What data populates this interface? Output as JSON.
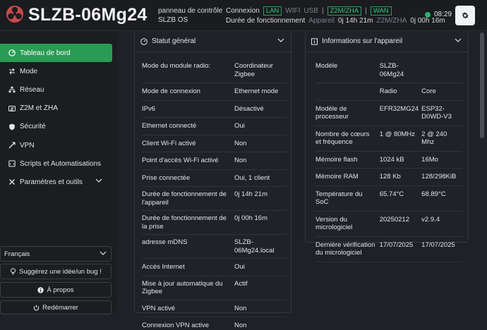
{
  "header": {
    "brand": "SLZB-06Mg24",
    "subtitle_line1": "panneau de contrôle",
    "subtitle_line2": "SLZB OS",
    "connection_label": "Connexion",
    "lan": "LAN",
    "wifi": "WIFI",
    "usb": "USB",
    "z2m_zha": "Z2M/ZHA",
    "wan": "WAN",
    "uptime_label": "Durée de fonctionnement",
    "appareil": "Appareil",
    "appareil_uptime": "0j 14h 21m",
    "z2m_label": "Z2M/ZHA",
    "z2m_uptime": "0j 00h 16m",
    "time": "08:29"
  },
  "sidebar": {
    "items": [
      {
        "label": "Tableau de bord",
        "icon": "dashboard-icon"
      },
      {
        "label": "Mode",
        "icon": "arrows-icon"
      },
      {
        "label": "Réseau",
        "icon": "network-icon"
      },
      {
        "label": "Z2M et ZHA",
        "icon": "zigbee-icon"
      },
      {
        "label": "Sécurité",
        "icon": "shield-icon"
      },
      {
        "label": "VPN",
        "icon": "vpn-icon"
      },
      {
        "label": "Scripts et Automatisations",
        "icon": "code-icon"
      },
      {
        "label": "Paramètres et outils",
        "icon": "tools-icon"
      }
    ],
    "language": "Français",
    "suggest": "Suggérez une idée/un bug !",
    "about": "À propos",
    "restart": "Redémarrer"
  },
  "status": {
    "title": "Statut général",
    "rows": [
      [
        "Mode du module radio:",
        "Coordinateur Zigbee"
      ],
      [
        "Mode de connexion",
        "Ethernet mode"
      ],
      [
        "IPv6",
        "Désactivé"
      ],
      [
        "Ethernet connecté",
        "Oui"
      ],
      [
        "Client Wi-Fi activé",
        "Non"
      ],
      [
        "Point d'accès Wi-Fi activé",
        "Non"
      ],
      [
        "Prise connectée",
        "Oui, 1 client"
      ],
      [
        "Durée de fonctionnement de l'appareil",
        "0j 14h 21m"
      ],
      [
        "Durée de fonctionnement de la prise",
        "0j 00h 16m"
      ],
      [
        "adresse mDNS",
        "SLZB-06Mg24.local"
      ],
      [
        "Accès Internet",
        "Oui"
      ],
      [
        "Mise à jour automatique du Zigbee",
        "Actif"
      ],
      [
        "VPN activé",
        "Non"
      ],
      [
        "Connexion VPN active",
        "Non"
      ]
    ]
  },
  "device": {
    "title": "Informations sur l'appareil",
    "model_label": "Modèle",
    "model_value": "SLZB-06Mg24",
    "col_radio": "Radio",
    "col_core": "Core",
    "rows": [
      [
        "Modèle de processeur",
        "EFR32MG24",
        "ESP32-D0WD-V3"
      ],
      [
        "Nombre de cœurs et fréquence",
        "1 @ 80MHz",
        "2 @ 240 Mhz"
      ],
      [
        "Mémoire flash",
        "1024 kB",
        "16Mo"
      ],
      [
        "Mémoire RAM",
        "128 Kb",
        "128/298KiB"
      ],
      [
        "Température du SoC",
        "65.74°C",
        "68.89°C"
      ],
      [
        "Version du micrologiciel",
        "20250212",
        "v2.9.4"
      ],
      [
        "Dernière vérification du micrologiciel",
        "17/07/2025",
        "17/07/2025"
      ]
    ]
  },
  "colors": {
    "accent": "#2a9b55",
    "badge_green": "#3cc47a",
    "background": "#1e2126",
    "logo_red": "#c74a4a"
  }
}
